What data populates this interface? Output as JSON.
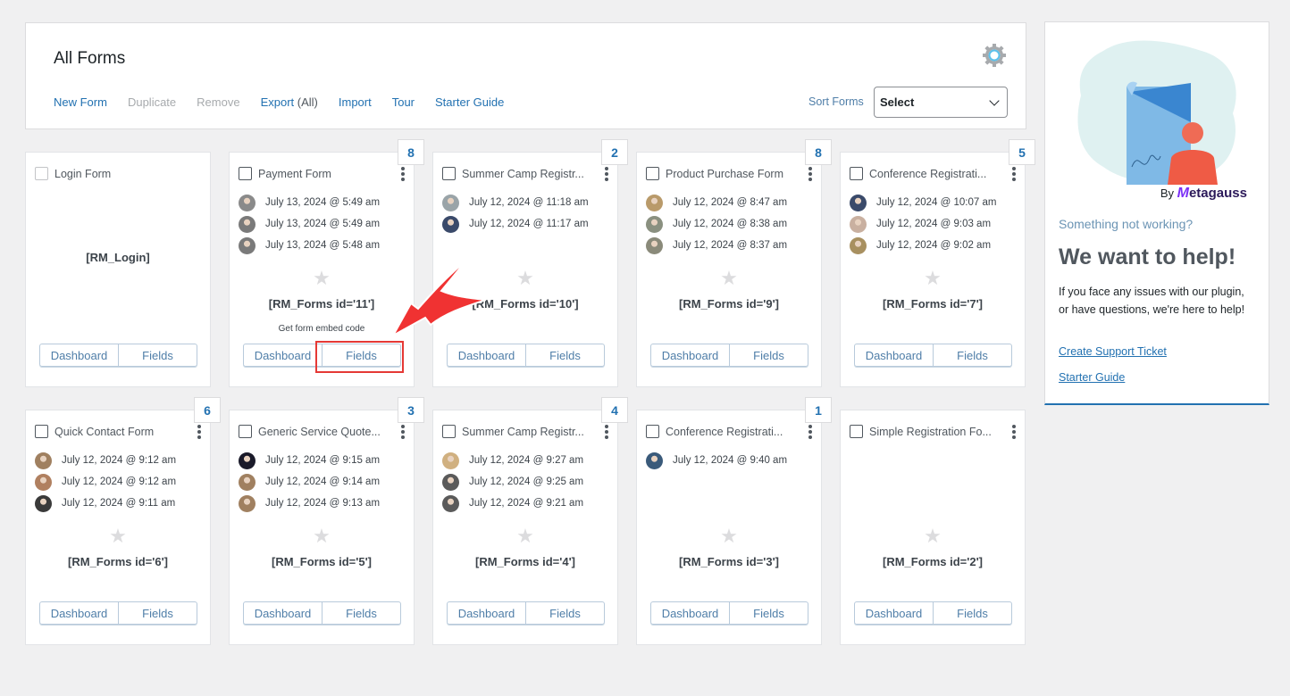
{
  "header": {
    "title": "All Forms",
    "toolbar": [
      {
        "label": "New Form",
        "disabled": false
      },
      {
        "label": "Duplicate",
        "disabled": true
      },
      {
        "label": "Remove",
        "disabled": true
      },
      {
        "label": "Export",
        "suffix": " (All)",
        "disabled": false
      },
      {
        "label": "Import",
        "disabled": false
      },
      {
        "label": "Tour",
        "disabled": false
      },
      {
        "label": "Starter Guide",
        "disabled": false
      }
    ],
    "settings_icon": "gear-icon",
    "sort_label": "Sort Forms",
    "sort_value": "Select"
  },
  "forms": [
    {
      "title": "Login Form",
      "count": null,
      "submissions": [],
      "shortcode": "[RM_Login]",
      "star": false,
      "dashboard": "Dashboard",
      "fields": "Fields"
    },
    {
      "title": "Payment Form",
      "count": "8",
      "submissions": [
        "July 13, 2024 @ 5:49 am",
        "July 13, 2024 @ 5:49 am",
        "July 13, 2024 @ 5:48 am"
      ],
      "shortcode": "[RM_Forms id='11']",
      "embed_hint": "Get form embed code",
      "star": true,
      "dashboard": "Dashboard",
      "fields": "Fields"
    },
    {
      "title": "Summer Camp Registr...",
      "count": "2",
      "submissions": [
        "July 12, 2024 @ 11:18 am",
        "July 12, 2024 @ 11:17 am"
      ],
      "shortcode": "[RM_Forms id='10']",
      "star": true,
      "dashboard": "Dashboard",
      "fields": "Fields"
    },
    {
      "title": "Product Purchase Form",
      "count": "8",
      "submissions": [
        "July 12, 2024 @ 8:47 am",
        "July 12, 2024 @ 8:38 am",
        "July 12, 2024 @ 8:37 am"
      ],
      "shortcode": "[RM_Forms id='9']",
      "star": true,
      "dashboard": "Dashboard",
      "fields": "Fields"
    },
    {
      "title": "Conference Registrati...",
      "count": "5",
      "submissions": [
        "July 12, 2024 @ 10:07 am",
        "July 12, 2024 @ 9:03 am",
        "July 12, 2024 @ 9:02 am"
      ],
      "shortcode": "[RM_Forms id='7']",
      "star": true,
      "dashboard": "Dashboard",
      "fields": "Fields"
    },
    {
      "title": "Quick Contact Form",
      "count": "6",
      "submissions": [
        "July 12, 2024 @ 9:12 am",
        "July 12, 2024 @ 9:12 am",
        "July 12, 2024 @ 9:11 am"
      ],
      "shortcode": "[RM_Forms id='6']",
      "star": true,
      "dashboard": "Dashboard",
      "fields": "Fields"
    },
    {
      "title": "Generic Service Quote...",
      "count": "3",
      "submissions": [
        "July 12, 2024 @ 9:15 am",
        "July 12, 2024 @ 9:14 am",
        "July 12, 2024 @ 9:13 am"
      ],
      "shortcode": "[RM_Forms id='5']",
      "star": true,
      "dashboard": "Dashboard",
      "fields": "Fields"
    },
    {
      "title": "Summer Camp Registr...",
      "count": "4",
      "submissions": [
        "July 12, 2024 @ 9:27 am",
        "July 12, 2024 @ 9:25 am",
        "July 12, 2024 @ 9:21 am"
      ],
      "shortcode": "[RM_Forms id='4']",
      "star": true,
      "dashboard": "Dashboard",
      "fields": "Fields"
    },
    {
      "title": "Conference Registrati...",
      "count": "1",
      "submissions": [
        "July 12, 2024 @ 9:40 am"
      ],
      "shortcode": "[RM_Forms id='3']",
      "star": true,
      "dashboard": "Dashboard",
      "fields": "Fields"
    },
    {
      "title": "Simple Registration Fo...",
      "count": null,
      "submissions": [],
      "shortcode": "[RM_Forms id='2']",
      "star": true,
      "dashboard": "Dashboard",
      "fields": "Fields"
    }
  ],
  "help": {
    "by_prefix": "By",
    "brand": "etagauss",
    "brand_mark": "M",
    "question": "Something not working?",
    "heading": "We want to help!",
    "body": "If you face any issues with our plugin, or have questions, we're here to help!",
    "link_ticket": "Create Support Ticket",
    "link_guide": "Starter Guide"
  },
  "annotation": {
    "highlight_target": "Fields",
    "color": "#e53935"
  }
}
